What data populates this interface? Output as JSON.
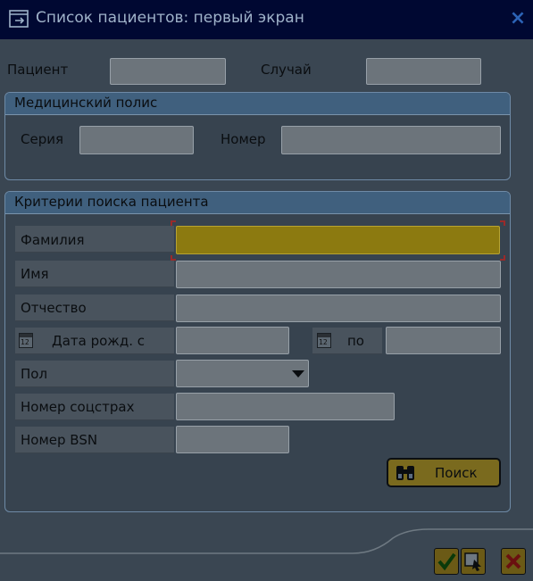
{
  "window": {
    "title": "Список пациентов: первый экран",
    "close": "×"
  },
  "top_fields": {
    "patient_label": "Пациент",
    "patient_value": "",
    "case_label": "Случай",
    "case_value": ""
  },
  "policy_group": {
    "title": "Медицинский полис",
    "series_label": "Серия",
    "series_value": "",
    "number_label": "Номер",
    "number_value": ""
  },
  "search_group": {
    "title": "Критерии поиска пациента",
    "lastname_label": "Фамилия",
    "lastname_value": "",
    "firstname_label": "Имя",
    "firstname_value": "",
    "patronymic_label": "Отчество",
    "patronymic_value": "",
    "birthdate_from_label": "Дата рожд. с",
    "birthdate_from_value": "",
    "birthdate_to_label": "по",
    "birthdate_to_value": "",
    "calendar_day": "12",
    "sex_label": "Пол",
    "sex_value": "",
    "ssn_label": "Номер соцстрах",
    "ssn_value": "",
    "bsn_label": "Номер BSN",
    "bsn_value": "",
    "search_button": "Поиск"
  },
  "footer": {
    "buttons": [
      "checkmark-icon",
      "select-icon",
      "cancel-icon"
    ]
  },
  "colors": {
    "focus_field": "#8c7a10",
    "title_bar": "#000832",
    "accent_group": "#40607e"
  }
}
